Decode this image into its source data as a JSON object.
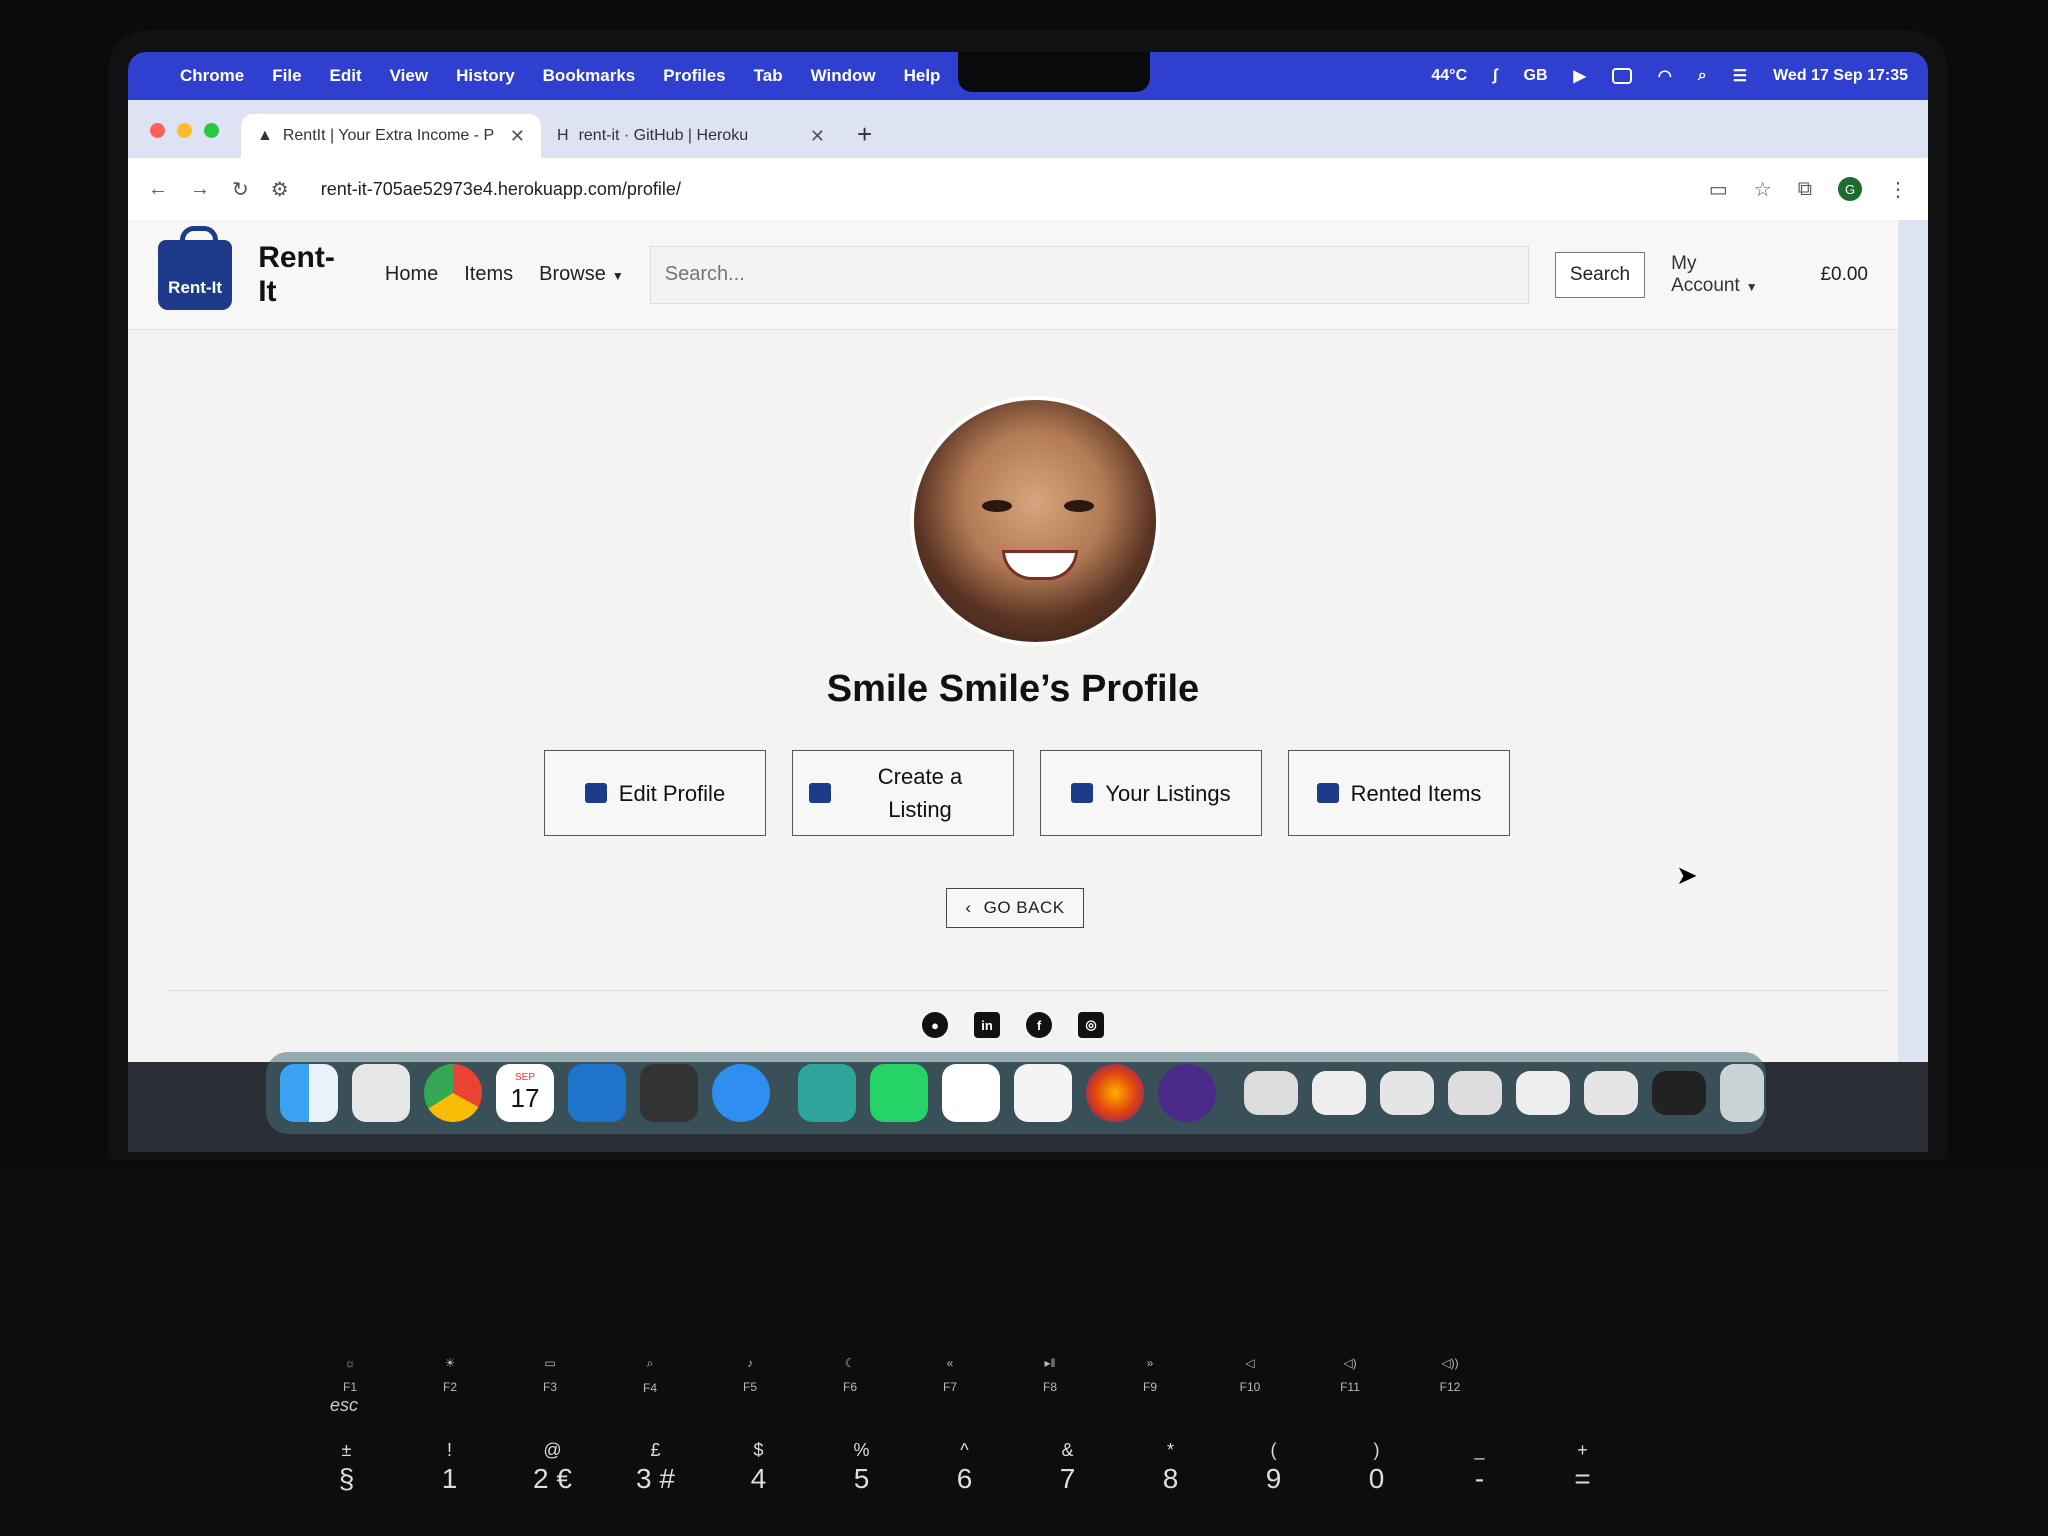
{
  "menubar": {
    "app": "Chrome",
    "items": [
      "File",
      "Edit",
      "View",
      "History",
      "Bookmarks",
      "Profiles",
      "Tab",
      "Window",
      "Help"
    ],
    "temperature": "44°C",
    "lang": "GB",
    "datetime": "Wed 17 Sep  17:35"
  },
  "tabs": [
    {
      "title": "RentIt | Your Extra Income - P"
    },
    {
      "title": "rent-it · GitHub | Heroku"
    }
  ],
  "toolbar": {
    "url": "rent-it-705ae52973e4.herokuapp.com/profile/",
    "profile_initial": "G"
  },
  "site": {
    "logo_text": "Rent-It",
    "brand": "Rent-It",
    "nav": {
      "home": "Home",
      "items": "Items",
      "browse": "Browse"
    },
    "search_placeholder": "Search...",
    "search_button": "Search",
    "account": "My Account",
    "cart_total": "£0.00"
  },
  "profile": {
    "title": "Smile Smile’s Profile",
    "actions": {
      "edit": "Edit Profile",
      "create": "Create a Listing",
      "listings": "Your Listings",
      "rented": "Rented Items"
    },
    "go_back": "GO BACK"
  },
  "footer": {
    "socials": [
      "github-icon",
      "linkedin-icon",
      "facebook-icon",
      "instagram-icon"
    ]
  },
  "dock": {
    "apps": [
      "Finder",
      "Launchpad",
      "Chrome",
      "Calendar",
      "VS Code",
      "Calculator",
      "Safari",
      "Scrivener",
      "WhatsApp",
      "Slack",
      "Keychain",
      "Firefox",
      "Tor Browser"
    ],
    "calendar_month": "SEP",
    "calendar_day": "17"
  },
  "keyboard": {
    "esc": "esc",
    "fkeys": [
      "F1",
      "F2",
      "F3",
      "F4",
      "F5",
      "F6",
      "F7",
      "F8",
      "F9",
      "F10",
      "F11",
      "F12"
    ],
    "numbers": [
      {
        "top": "±",
        "main": "§"
      },
      {
        "top": "!",
        "main": "1"
      },
      {
        "top": "@",
        "main": "2 €"
      },
      {
        "top": "£",
        "main": "3 #"
      },
      {
        "top": "$",
        "main": "4"
      },
      {
        "top": "%",
        "main": "5"
      },
      {
        "top": "^",
        "main": "6"
      },
      {
        "top": "&",
        "main": "7"
      },
      {
        "top": "*",
        "main": "8"
      },
      {
        "top": "(",
        "main": "9"
      },
      {
        "top": ")",
        "main": "0"
      },
      {
        "top": "_",
        "main": "-"
      },
      {
        "top": "+",
        "main": "="
      }
    ]
  }
}
